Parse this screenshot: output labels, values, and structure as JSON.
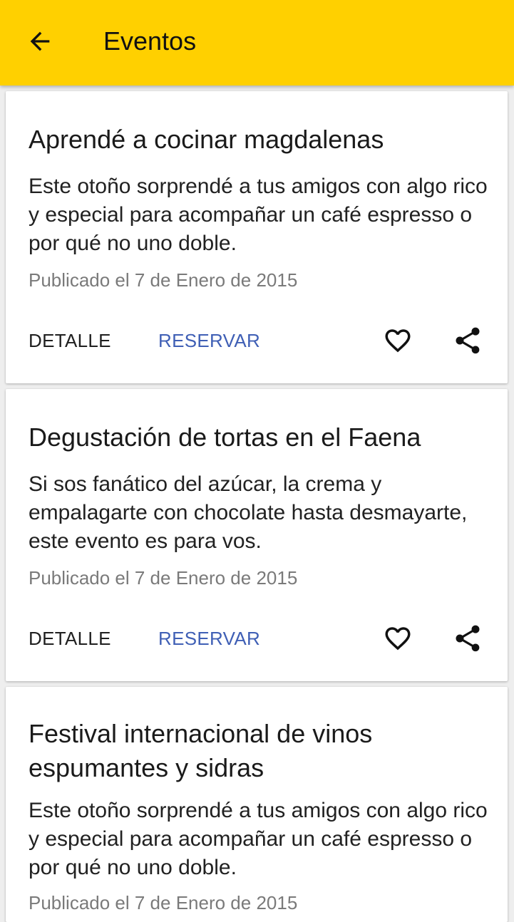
{
  "appbar": {
    "title": "Eventos",
    "back_icon": "arrow-back-icon",
    "color": "#ffd000"
  },
  "events": [
    {
      "title": "Aprendé a cocinar magdalenas",
      "description": "Este otoño sorprendé a tus amigos con algo rico y especial para acompañar un café espresso o por qué no uno doble.",
      "date": "Publicado el 7 de Enero de 2015",
      "detail_label": "DETALLE",
      "reserve_label": "RESERVAR",
      "favorite_icon": "heart-outline-icon",
      "share_icon": "share-icon"
    },
    {
      "title": "Degustación de tortas en el Faena",
      "description": "Si sos fanático del azúcar, la crema y empalagarte con chocolate hasta desmayarte, este evento es para vos.",
      "date": "Publicado el 7 de Enero de 2015",
      "detail_label": "DETALLE",
      "reserve_label": "RESERVAR",
      "favorite_icon": "heart-outline-icon",
      "share_icon": "share-icon"
    },
    {
      "title": "Festival internacional de vinos espumantes y sidras",
      "description": "Este otoño sorprendé a tus amigos con algo rico y especial para acompañar un café espresso o por qué no uno doble.",
      "date": "Publicado el 7 de Enero de 2015"
    }
  ],
  "colors": {
    "accent_link": "#3f5fb5",
    "background": "#eeeeee"
  }
}
